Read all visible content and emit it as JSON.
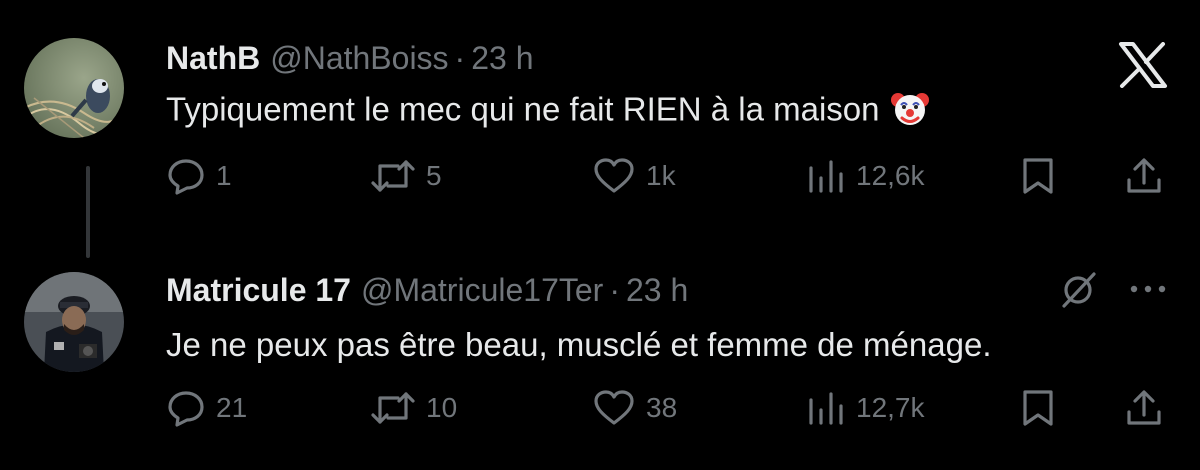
{
  "logo": {
    "icon": "x-logo-icon"
  },
  "tweets": [
    {
      "display_name": "NathB",
      "handle": "@NathBoiss",
      "separator": "·",
      "time": "23 h",
      "text": "Typiquement le mec qui ne fait RIEN à la maison",
      "emoji": "clown-face-icon",
      "replies": "1",
      "retweets": "5",
      "likes": "1k",
      "views": "12,6k"
    },
    {
      "display_name": "Matricule 17",
      "handle": "@Matricule17Ter",
      "separator": "·",
      "time": "23 h",
      "text": "Je ne peux pas être beau, musclé et femme de ménage.",
      "replies": "21",
      "retweets": "10",
      "likes": "38",
      "views": "12,7k"
    }
  ],
  "colors": {
    "background": "#000000",
    "text": "#e7e9ea",
    "muted": "#71767b",
    "thread_line": "#333639"
  }
}
